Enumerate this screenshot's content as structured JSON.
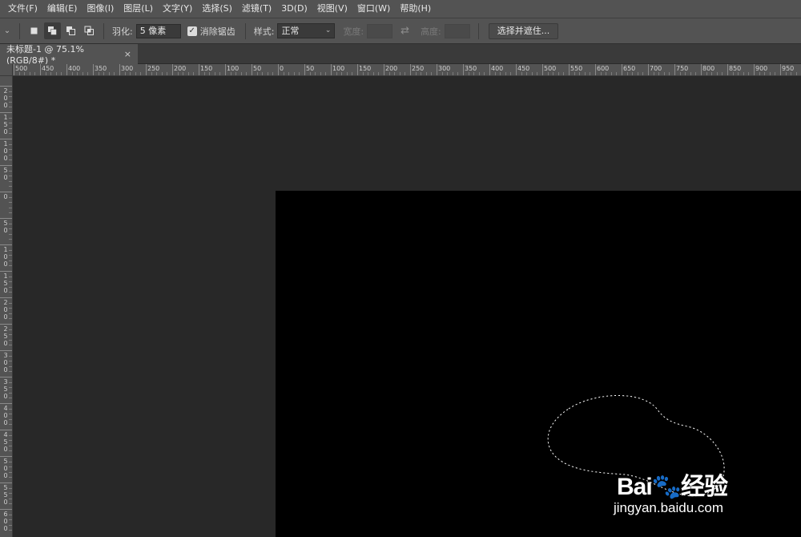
{
  "menu": [
    "文件(F)",
    "编辑(E)",
    "图像(I)",
    "图层(L)",
    "文字(Y)",
    "选择(S)",
    "滤镜(T)",
    "3D(D)",
    "视图(V)",
    "窗口(W)",
    "帮助(H)"
  ],
  "options": {
    "feather_label": "羽化:",
    "feather_value": "5 像素",
    "antialias_label": "消除锯齿",
    "antialias_checked": true,
    "style_label": "样式:",
    "style_value": "正常",
    "width_label": "宽度:",
    "height_label": "高度:",
    "select_mask_button": "选择并遮住..."
  },
  "document_tab": {
    "title": "未标题-1 @ 75.1%(RGB/8#) *",
    "close": "×"
  },
  "rulers": {
    "horizontal_labels": [
      "500",
      "450",
      "400",
      "350",
      "300",
      "250",
      "200",
      "150",
      "100",
      "50",
      "0",
      "50",
      "100",
      "150",
      "200",
      "250",
      "300",
      "350",
      "400",
      "450",
      "500",
      "550",
      "600",
      "650",
      "700",
      "750",
      "800",
      "850",
      "900",
      "950"
    ],
    "vertical_labels": [
      "2\n0\n0",
      "1\n5\n0",
      "1\n0\n0",
      "5\n0",
      "0",
      "5\n0",
      "1\n0\n0",
      "1\n5\n0",
      "2\n0\n0",
      "2\n5\n0",
      "3\n0\n0",
      "3\n5\n0",
      "4\n0\n0",
      "4\n5\n0",
      "5\n0\n0",
      "5\n5\n0",
      "6\n0\n0"
    ]
  },
  "watermark": {
    "brand": "Bai🐾经验",
    "url": "jingyan.baidu.com"
  },
  "colors": {
    "chrome": "#535353",
    "workspace": "#282828",
    "canvas": "#000000"
  }
}
